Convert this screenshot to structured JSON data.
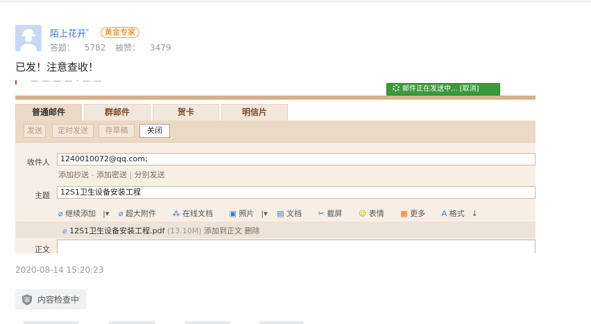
{
  "answer": {
    "username": "陌上花开゛",
    "rank_badge": "黄金专家",
    "stats": {
      "answers_label": "答题：",
      "answers": "5782",
      "likes_label": "被赞：",
      "likes": "3479"
    },
    "text": "已发！注意查收！",
    "timestamp": "2020-08-14 15:20:23",
    "review_status": "内容检查中"
  },
  "screenshot": {
    "sending_status": "邮件正在发送中... [取消]",
    "tabs": [
      {
        "label": "普通邮件"
      },
      {
        "label": "群邮件"
      },
      {
        "label": "贺卡"
      },
      {
        "label": "明信片"
      }
    ],
    "toolbar": [
      {
        "label": "发送"
      },
      {
        "label": "定时发送"
      },
      {
        "label": "存草稿"
      },
      {
        "label": "关闭"
      }
    ],
    "recipient_label": "收件人",
    "recipient_value": "1240010072@qq.com;",
    "sublinks": {
      "cc": "添加抄送",
      "bcc": "添加密送",
      "separate": "分别发送"
    },
    "subject_label": "主题",
    "subject_value": "12S1卫生设备安装工程",
    "attach_tools": [
      "继续添加",
      "超大附件",
      "在线文档",
      "照片",
      "文档",
      "截屏",
      "表情",
      "更多",
      "格式"
    ],
    "attachment": {
      "name": "12S1卫生设备安装工程.pdf",
      "size": "(13.10M)",
      "add_to_body": "添加到正文",
      "delete": "删除"
    },
    "body_label": "正文"
  },
  "colors": {
    "link_blue": "#3d74c1",
    "rank_orange": "#e07b00",
    "sending_green": "#3a9a3a",
    "mail_accent": "#d9b08a"
  }
}
